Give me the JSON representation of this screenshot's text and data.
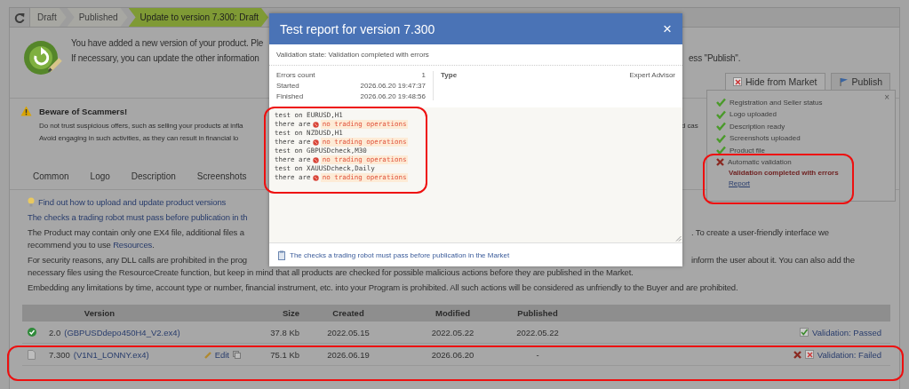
{
  "breadcrumb": {
    "steps": [
      {
        "label": "Draft",
        "selected": false
      },
      {
        "label": "Published",
        "selected": false
      },
      {
        "label": "Update to version 7.300: Draft",
        "selected": true
      }
    ]
  },
  "notice": {
    "lines": [
      {
        "left": "You have added a new version of your product. Ple"
      },
      {
        "left": "If necessary, you can update the other information",
        "right": "ess \"Publish\"."
      }
    ]
  },
  "actions": [
    {
      "kind": "hide",
      "label": "Hide from Market"
    },
    {
      "kind": "publish",
      "label": "Publish"
    }
  ],
  "warning": {
    "title": "Beware of Scammers!",
    "lines": [
      {
        "left": "Do not trust suspicious offers, such as selling your products at infla",
        "right": "d cas"
      },
      {
        "left": "Avoid engaging in such activities, as they can result in financial lo"
      }
    ]
  },
  "tabs": [
    "Common",
    "Logo",
    "Description",
    "Screenshots"
  ],
  "help_link": "Find out how to upload and update product versions",
  "checks_link": "The checks a trading robot must pass before publication in th",
  "paragraphs": [
    {
      "lines": [
        {
          "left": "The Product may contain only one EX4 file, additional files a",
          "right": ". To create a user-friendly interface we"
        },
        {
          "left": "recommend you to use ",
          "link": "Resources",
          "tail": "."
        }
      ]
    },
    {
      "lines": [
        {
          "left": "For security reasons, any DLL calls are prohibited in the prog",
          "right": "inform the user about it. You can also add the"
        },
        {
          "left": "necessary files using the ResourceCreate function, but keep in mind that all products are checked for possible malicious actions before they are published in the Market."
        }
      ]
    },
    {
      "lines": [
        {
          "left": "Embedding any limitations by time, account type or number, financial instrument, etc. into your Program is prohibited. All such actions will be considered as unfriendly to the Buyer and are prohibited."
        }
      ]
    }
  ],
  "table": {
    "columns": [
      "Version",
      "Size",
      "Created",
      "Modified",
      "Published"
    ],
    "rows": [
      {
        "kind": "published",
        "version": "2.0",
        "file": "(GBPUSDdepo450H4_V2.ex4)",
        "size": "37.8 Kb",
        "created": "2022.05.15",
        "modified": "2022.05.22",
        "published": "2022.05.22",
        "validation": "Validation: Passed"
      },
      {
        "kind": "draft",
        "version": "7.300",
        "file": "(V1N1_LONNY.ex4)",
        "edit": "Edit",
        "size": "75.1 Kb",
        "created": "2026.06.19",
        "modified": "2026.06.20",
        "published": "-",
        "validation": "Validation: Failed"
      }
    ]
  },
  "checklist": {
    "close": "×",
    "items": [
      {
        "kind": "done",
        "label": "Registration and Seller status"
      },
      {
        "kind": "done",
        "label": "Logo uploaded"
      },
      {
        "kind": "done",
        "label": "Description ready"
      },
      {
        "kind": "done",
        "label": "Screenshots uploaded"
      },
      {
        "kind": "done",
        "label": "Product file"
      },
      {
        "kind": "failed",
        "label": "Automatic validation"
      }
    ],
    "error": "Validation completed with errors",
    "report_link": "Report"
  },
  "modal": {
    "title": "Test report for version 7.300",
    "close": "×",
    "state": "Validation state: Validation completed with errors",
    "stats": [
      {
        "label": "Errors count",
        "value": "1"
      },
      {
        "label": "Started",
        "value": "2026.06.20 19:47:37"
      },
      {
        "label": "Finished",
        "value": "2026.06.20 19:48:56"
      }
    ],
    "type": {
      "label": "Type",
      "value": "Expert Advisor"
    },
    "log": [
      {
        "kind": "test",
        "text": "test on EURUSD,H1"
      },
      {
        "kind": "result",
        "text": "there are",
        "message": "no trading operations"
      },
      {
        "kind": "test",
        "text": "test on NZDUSD,H1"
      },
      {
        "kind": "result",
        "text": "there are",
        "message": "no trading operations"
      },
      {
        "kind": "test",
        "text": "test on GBPUSDcheck,M30"
      },
      {
        "kind": "result",
        "text": "there are",
        "message": "no trading operations"
      },
      {
        "kind": "test",
        "text": "test on XAUUSDcheck,Daily"
      },
      {
        "kind": "result",
        "text": "there are",
        "message": "no trading operations"
      }
    ],
    "footer_link": "The checks a trading robot must pass before publication in the Market"
  }
}
